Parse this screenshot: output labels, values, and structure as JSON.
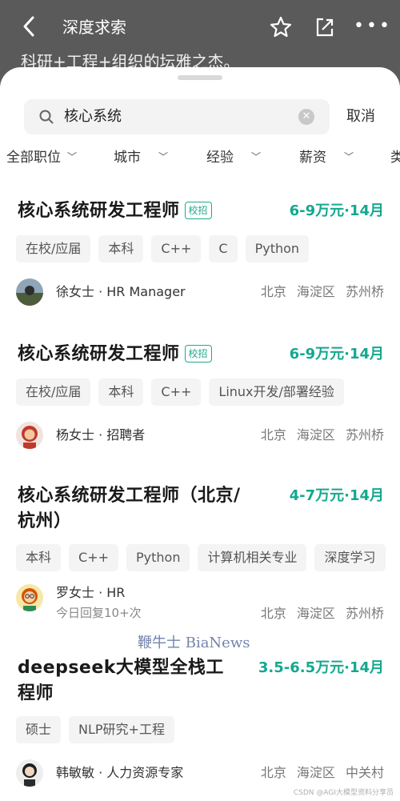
{
  "header": {
    "back_icon": "chevron-left-icon",
    "title": "深度求索",
    "bg_text": "科研+工程+组织的坛雅之杰。",
    "icons": [
      "star-icon",
      "share-icon",
      "more-icon"
    ]
  },
  "search": {
    "query": "核心系统",
    "cancel": "取消"
  },
  "filters": [
    "全部职位",
    "城市",
    "经验",
    "薪资",
    "类"
  ],
  "jobs": [
    {
      "title": "核心系统研发工程师",
      "badge": "校招",
      "salary": "6-9万元·14月",
      "tags": [
        "在校/应届",
        "本科",
        "C++",
        "C",
        "Python"
      ],
      "recruiter": "徐女士 · HR Manager",
      "sub": "",
      "location": "北京 海淀区 苏州桥"
    },
    {
      "title": "核心系统研发工程师",
      "badge": "校招",
      "salary": "6-9万元·14月",
      "tags": [
        "在校/应届",
        "本科",
        "C++",
        "Linux开发/部署经验"
      ],
      "recruiter": "杨女士 · 招聘者",
      "sub": "",
      "location": "北京 海淀区 苏州桥"
    },
    {
      "title_line1": "核心系统研发工程师（北京/",
      "title_line2": "杭州）",
      "salary": "4-7万元·14月",
      "tags": [
        "本科",
        "C++",
        "Python",
        "计算机相关专业",
        "深度学习"
      ],
      "recruiter": "罗女士 · HR",
      "sub": "今日回复10+次",
      "location": "北京 海淀区 苏州桥"
    },
    {
      "title_line1": "deepseek大模型全栈工",
      "title_line2": "程师",
      "salary": "3.5-6.5万元·14月",
      "tags": [
        "硕士",
        "NLP研究+工程"
      ],
      "recruiter": "韩敏敏 · 人力资源专家",
      "sub": "",
      "location": "北京 海淀区 中关村"
    }
  ],
  "watermark": "鞭牛士 BiaNews",
  "footer_mark": "CSDN @AGI大模型资料分享员",
  "colors": {
    "accent": "#15a88e",
    "overlay": "#5a5a5a"
  }
}
